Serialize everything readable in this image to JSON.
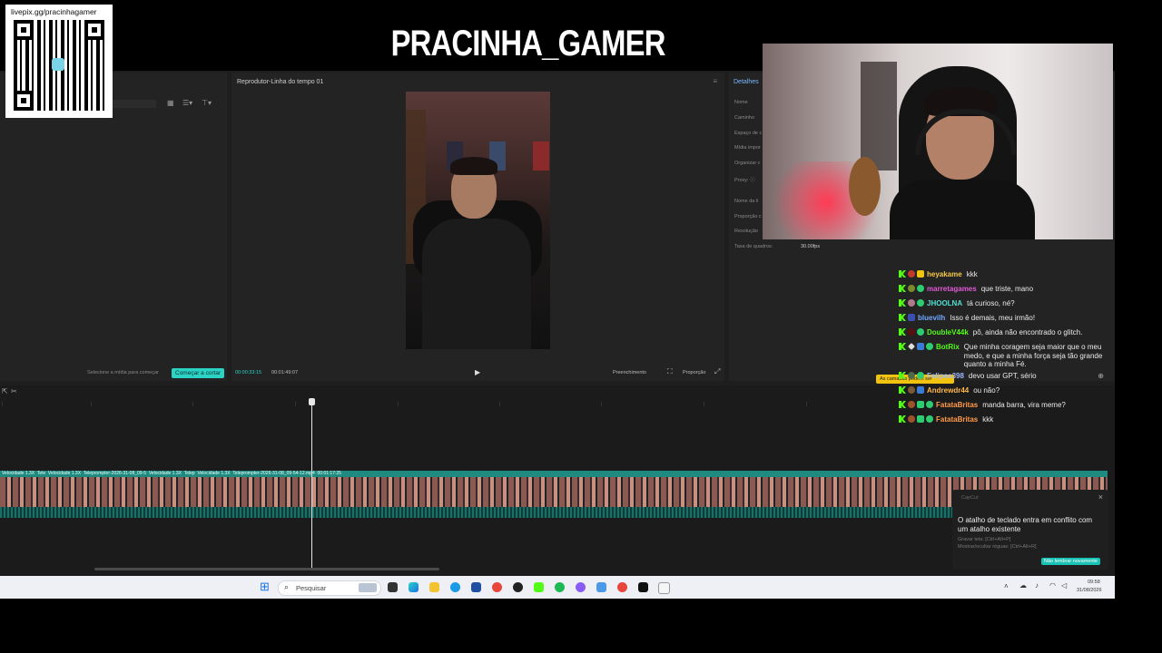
{
  "qr": {
    "url": "livepix.gg/pracinhagamer"
  },
  "overlay": {
    "channel_title": "PRACINHA_GAMER"
  },
  "editor": {
    "player_title": "Reprodutor-Linha do tempo 01",
    "details_title": "Detalhes",
    "details_fields": [
      "Nome",
      "Caminho",
      "Espaço de c",
      "Mídia impor",
      "Organizar c",
      "Proxy: ⓘ",
      "Nome da li",
      "Proporção c",
      "Resolução",
      "Taxa de quadros:"
    ],
    "frame_rate": "30.00fps",
    "media_hint": "Selecione a mídia para começar",
    "start_cut_label": "Começar a cortar",
    "current_time": "00:00:33:15",
    "total_time": "00:01:49:07",
    "fill_label": "Preenchimento",
    "ratio_label": "Proporção",
    "clip_labels": [
      "Velocidade 1.3X",
      "Tele",
      "Velocidade 1.3X",
      "Teleprompter-2026-31-08_09-5",
      "Velocidade 1.3X",
      "Telep",
      "Velocidade 1.3X",
      "Teleprompter-2026-31-08_09-54-12.mp4",
      "00:01:17:25"
    ],
    "layers_hint": "As camadas podem ser"
  },
  "chat": [
    {
      "user": "heyakame",
      "color": "#f7c948",
      "text": "kkk"
    },
    {
      "user": "marretagames",
      "color": "#e05ad6",
      "text": "que triste, mano"
    },
    {
      "user": "JHOOLNA",
      "color": "#4fe0d2",
      "text": "tá curioso, né?"
    },
    {
      "user": "bluevilh",
      "color": "#6fa8ff",
      "text": "Isso é demais, meu irmão!"
    },
    {
      "user": "DoubleV44k",
      "color": "#53fc18",
      "text": "pô, ainda não encontrado o glitch."
    },
    {
      "user": "BotRix",
      "color": "#53fc18",
      "text": "Que minha coragem seja maior que o meu medo, e que a minha força seja tão grande quanto a minha Fé."
    },
    {
      "user": "Felipee398",
      "color": "#9fb8ff",
      "text": "devo usar GPT, sério"
    },
    {
      "user": "Andrewdr44",
      "color": "#ffb84a",
      "text": "ou não?"
    },
    {
      "user": "FatataBritas",
      "color": "#ff9a4a",
      "text": "manda barra, vira meme?"
    },
    {
      "user": "FatataBritas",
      "color": "#ff9a4a",
      "text": "kkk"
    }
  ],
  "toast": {
    "app": "CapCut",
    "message": "O atalho de teclado entra em conflito com um atalho existente",
    "line1": "Gravar tela: [Ctrl+Alt+P]",
    "line2": "Mostrar/ocultar réguas: [Ctrl+Alt+R]",
    "button": "Não lembrar novamente"
  },
  "taskbar": {
    "search_placeholder": "Pesquisar",
    "time": "09:58",
    "date": "31/08/2026"
  }
}
